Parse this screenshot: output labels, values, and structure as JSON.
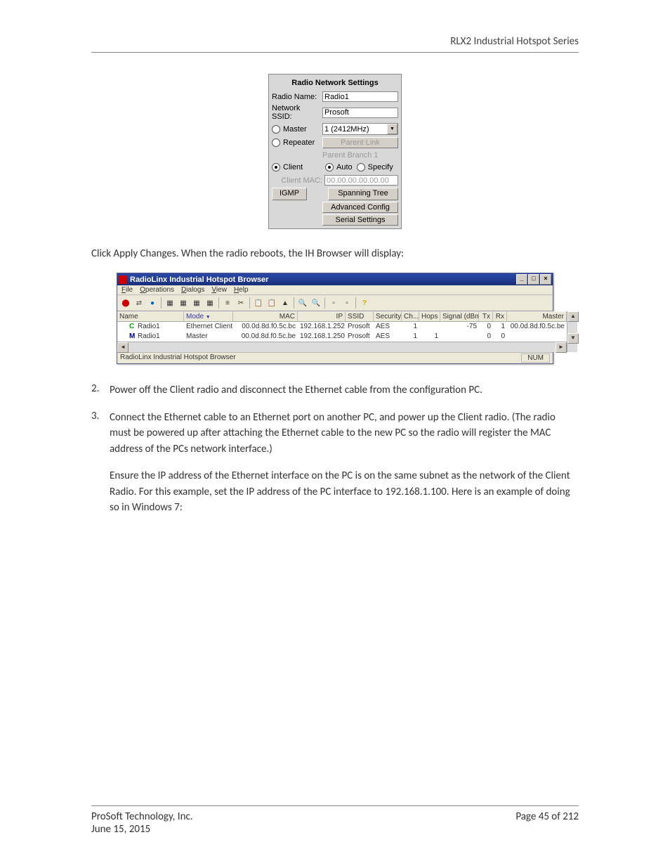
{
  "header": {
    "title": "RLX2 Industrial Hotspot Series"
  },
  "settings_panel": {
    "title": "Radio Network Settings",
    "radio_name_label": "Radio Name:",
    "radio_name_value": "Radio1",
    "ssid_label": "Network SSID:",
    "ssid_value": "Prosoft",
    "master_label": "Master",
    "channel_value": "1 (2412MHz)",
    "repeater_label": "Repeater",
    "parent_link_btn": "Parent Link",
    "parent_branch_text": "Parent Branch 1",
    "client_label": "Client",
    "auto_label": "Auto",
    "specify_label": "Specify",
    "client_mac_label": "Client MAC:",
    "client_mac_value": "00.00.00.00.00.00",
    "igmp_btn": "IGMP",
    "spanning_tree_btn": "Spanning Tree",
    "advanced_btn": "Advanced Config",
    "serial_btn": "Serial Settings"
  },
  "instructions": {
    "line1": "Click Apply Changes. When the radio reboots, the IH Browser will display:",
    "step2_num": "2.",
    "step2": "Power off the Client radio and disconnect the Ethernet cable from the configuration PC.",
    "step3_num": "3.",
    "step3": "Connect the Ethernet cable to an Ethernet port on another PC, and power up the Client radio. (The radio must be powered up after attaching the Ethernet cable to the new PC so the radio will register the MAC address of the PCs network interface.)",
    "step3_para2": "Ensure the IP address of the Ethernet interface on the PC is on the same subnet as the network of the Client Radio. For this example, set the IP address of the PC interface to 192.168.1.100. Here is an example of doing so in Windows 7:"
  },
  "browser": {
    "title": "RadioLinx Industrial Hotspot Browser",
    "menu": {
      "file": "File",
      "operations": "Operations",
      "dialogs": "Dialogs",
      "view": "View",
      "help": "Help"
    },
    "columns": {
      "name": "Name",
      "mode": "Mode",
      "mac": "MAC",
      "ip": "IP",
      "ssid": "SSID",
      "security": "Security",
      "ch": "Ch...",
      "hops": "Hops",
      "signal": "Signal (dBm)",
      "tx": "Tx",
      "rx": "Rx",
      "master": "Master"
    },
    "rows": [
      {
        "icon": "C",
        "name": "Radio1",
        "mode": "Ethernet Client",
        "mac": "00.0d.8d.f0.5c.bc",
        "ip": "192.168.1.252",
        "ssid": "Prosoft",
        "security": "AES",
        "ch": "1",
        "hops": "",
        "signal": "-75",
        "tx": "0",
        "rx": "1",
        "master": "00.0d.8d.f0.5c.be"
      },
      {
        "icon": "M",
        "name": "Radio1",
        "mode": "Master",
        "mac": "00.0d.8d.f0.5c.be",
        "ip": "192.168.1.250",
        "ssid": "Prosoft",
        "security": "AES",
        "ch": "1",
        "hops": "1",
        "signal": "",
        "tx": "0",
        "rx": "0",
        "master": ""
      }
    ],
    "statusbar_text": "RadioLinx Industrial Hotspot Browser",
    "statusbar_num": "NUM"
  },
  "footer": {
    "company": "ProSoft Technology, Inc.",
    "date": "June 15, 2015",
    "page": "Page 45 of 212"
  }
}
